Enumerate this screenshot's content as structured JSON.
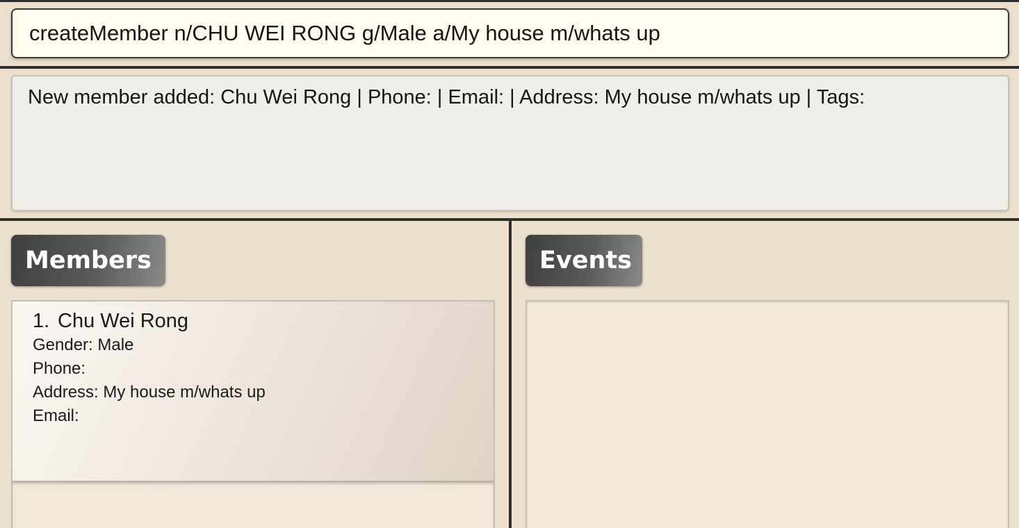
{
  "command": {
    "input_value": "createMember n/CHU WEI RONG g/Male a/My house m/whats up"
  },
  "result": {
    "message": "New member added: Chu Wei Rong | Phone:  | Email:  | Address: My house m/whats up | Tags:"
  },
  "members_panel": {
    "title": "Members",
    "items": [
      {
        "index": "1.",
        "name": "Chu Wei Rong",
        "gender": "Gender: Male",
        "phone": "Phone:",
        "address": "Address: My house m/whats up",
        "email": "Email:"
      }
    ]
  },
  "events_panel": {
    "title": "Events",
    "items": []
  }
}
